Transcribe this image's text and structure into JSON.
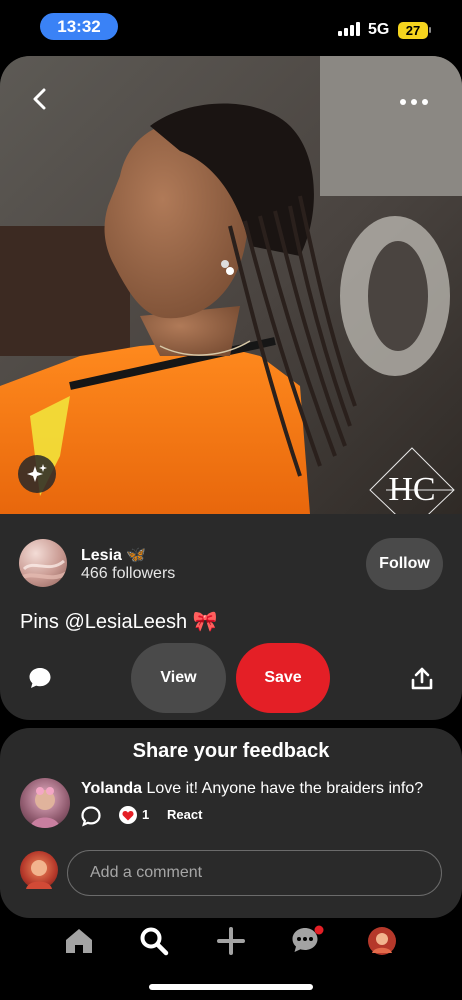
{
  "status_bar": {
    "time": "13:32",
    "network": "5G",
    "battery": "27"
  },
  "pin": {
    "creator_name": "Lesia 🦋",
    "followers": "466 followers",
    "follow_label": "Follow",
    "title": "Pins @LesiaLeesh 🎀",
    "view_label": "View",
    "save_label": "Save",
    "watermark": "HC"
  },
  "feedback": {
    "title": "Share your feedback",
    "comment": {
      "author": "Yolanda",
      "text": "Love it! Anyone have the braiders info?",
      "reaction_count": "1",
      "react_label": "React"
    },
    "input_placeholder": "Add a comment"
  },
  "colors": {
    "accent_blue": "#3a82f6",
    "save_red": "#e41f26",
    "battery_yellow": "#f5d41e",
    "card_bg": "#2a2a2a",
    "button_gray": "#4a4a4a",
    "notification_dot": "#e41f26"
  },
  "icons": [
    "back-arrow-icon",
    "more-dots-icon",
    "sparkle-icon",
    "comment-bubble-icon",
    "share-upload-icon",
    "reply-bubble-icon",
    "heart-reaction-icon",
    "home-icon",
    "search-icon",
    "plus-icon",
    "messages-icon",
    "profile-avatar"
  ]
}
